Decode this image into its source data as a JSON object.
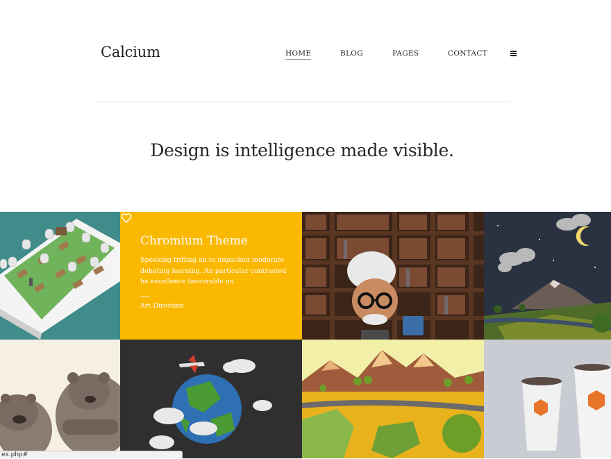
{
  "header": {
    "logo": "Calcium",
    "nav": [
      {
        "label": "HOME",
        "active": true
      },
      {
        "label": "BLOG",
        "active": false
      },
      {
        "label": "PAGES",
        "active": false
      },
      {
        "label": "CONTACT",
        "active": false
      }
    ],
    "menu_icon": "hamburger-icon"
  },
  "hero": {
    "tagline": "Design is intelligence made visible."
  },
  "portfolio": {
    "tiles": [
      {
        "subject": "isometric phone graveyard illustration"
      },
      {
        "subject": "hovered project",
        "overlay": true
      },
      {
        "subject": "old man with glasses in front of bookshelf"
      },
      {
        "subject": "low-poly night landscape with moon"
      },
      {
        "subject": "two grumpy bears illustration"
      },
      {
        "subject": "low-poly globe with airplane and clouds"
      },
      {
        "subject": "low-poly mountain landscape"
      },
      {
        "subject": "paper coffee cups mockup"
      }
    ],
    "hover_card": {
      "title": "Chromium Theme",
      "description": "Speaking trifling an to unpacked moderate debating learning. An particular contrasted he excellence favourable on.",
      "category": "Art Direction",
      "heart_icon": "heart-icon",
      "overlay_color": "#FBB800"
    }
  },
  "statusbar": {
    "url": "ex.php#"
  }
}
